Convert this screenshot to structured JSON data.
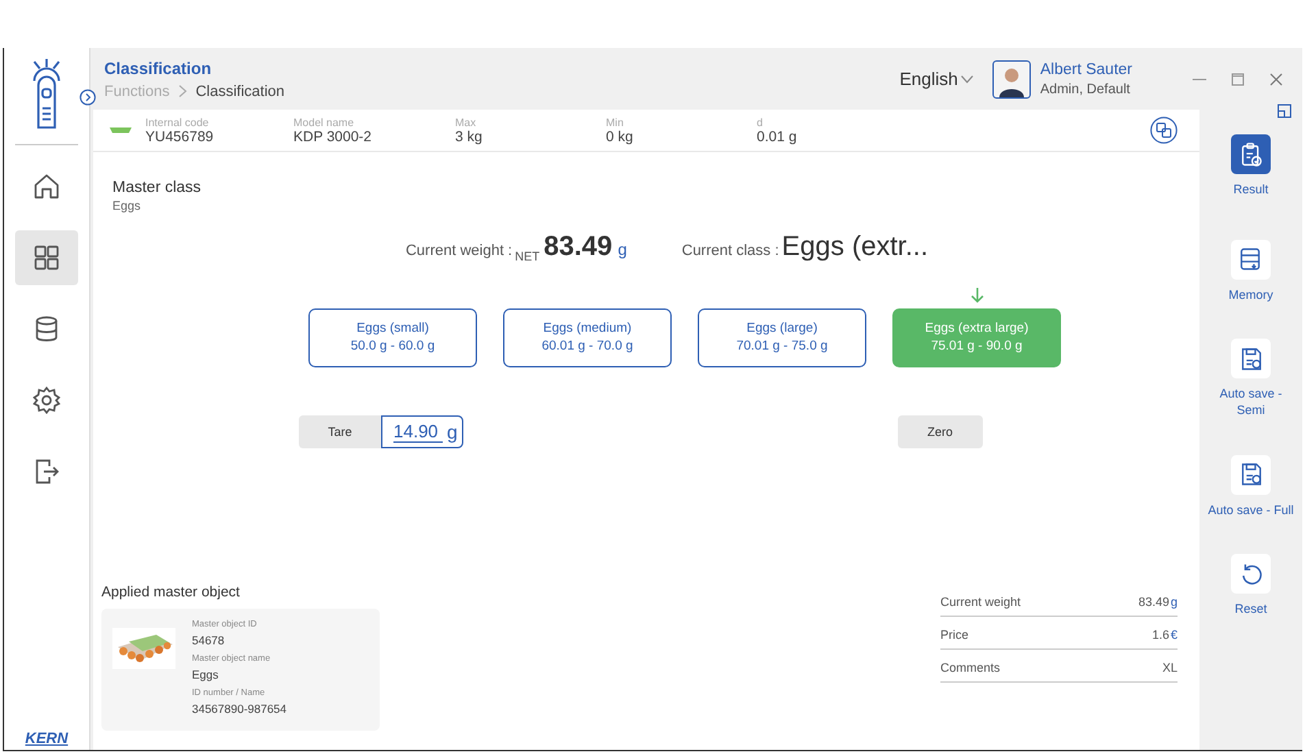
{
  "header": {
    "title": "Classification",
    "breadcrumb": [
      "Functions",
      "Classification"
    ],
    "language": "English",
    "user": {
      "name": "Albert Sauter",
      "role": "Admin, Default"
    }
  },
  "sidebar": {
    "items": [
      {
        "kind": "home",
        "selected": false
      },
      {
        "kind": "grid",
        "selected": true
      },
      {
        "kind": "database",
        "selected": false
      },
      {
        "kind": "gear",
        "selected": false
      },
      {
        "kind": "exit",
        "selected": false
      }
    ],
    "brand": "KERN"
  },
  "info": [
    {
      "label": "Internal code",
      "value": "YU456789"
    },
    {
      "label": "Model name",
      "value": "KDP 3000-2"
    },
    {
      "label": "Max",
      "value": "3 kg"
    },
    {
      "label": "Min",
      "value": "0 kg"
    },
    {
      "label": "d",
      "value": "0.01 g"
    }
  ],
  "master_class": {
    "title": "Master class",
    "value": "Eggs"
  },
  "readout": {
    "weight_label": "Current weight :",
    "net": "NET",
    "weight": "83.49",
    "unit": "g",
    "class_label": "Current class :",
    "class_value": "Eggs (extr..."
  },
  "classes": [
    {
      "name": "Eggs (small)",
      "range": "50.0 g - 60.0 g",
      "selected": false
    },
    {
      "name": "Eggs (medium)",
      "range": "60.01 g - 70.0 g",
      "selected": false
    },
    {
      "name": "Eggs (large)",
      "range": "70.01 g - 75.0 g",
      "selected": false
    },
    {
      "name": "Eggs (extra large)",
      "range": "75.01 g - 90.0 g",
      "selected": true
    }
  ],
  "tare": {
    "label": "Tare",
    "value": "14.90",
    "unit": "g"
  },
  "zero": {
    "label": "Zero"
  },
  "applied": {
    "title": "Applied master object",
    "fields": [
      {
        "label": "Master object ID",
        "value": "54678"
      },
      {
        "label": "Master object name",
        "value": "Eggs"
      },
      {
        "label": "ID number / Name",
        "value": "34567890-987654"
      }
    ]
  },
  "summary": [
    {
      "label": "Current weight",
      "value": "83.49",
      "unit": "g"
    },
    {
      "label": "Price",
      "value": "1.6",
      "unit": "€"
    },
    {
      "label": "Comments",
      "value": "XL"
    }
  ],
  "actions": [
    {
      "kind": "clipboard",
      "label": "Result",
      "selected": true
    },
    {
      "kind": "memory",
      "label": "Memory",
      "selected": false
    },
    {
      "kind": "save",
      "label": "Auto save - Semi",
      "selected": false
    },
    {
      "kind": "save",
      "label": "Auto save - Full",
      "selected": false
    },
    {
      "kind": "reset",
      "label": "Reset",
      "selected": false
    }
  ]
}
